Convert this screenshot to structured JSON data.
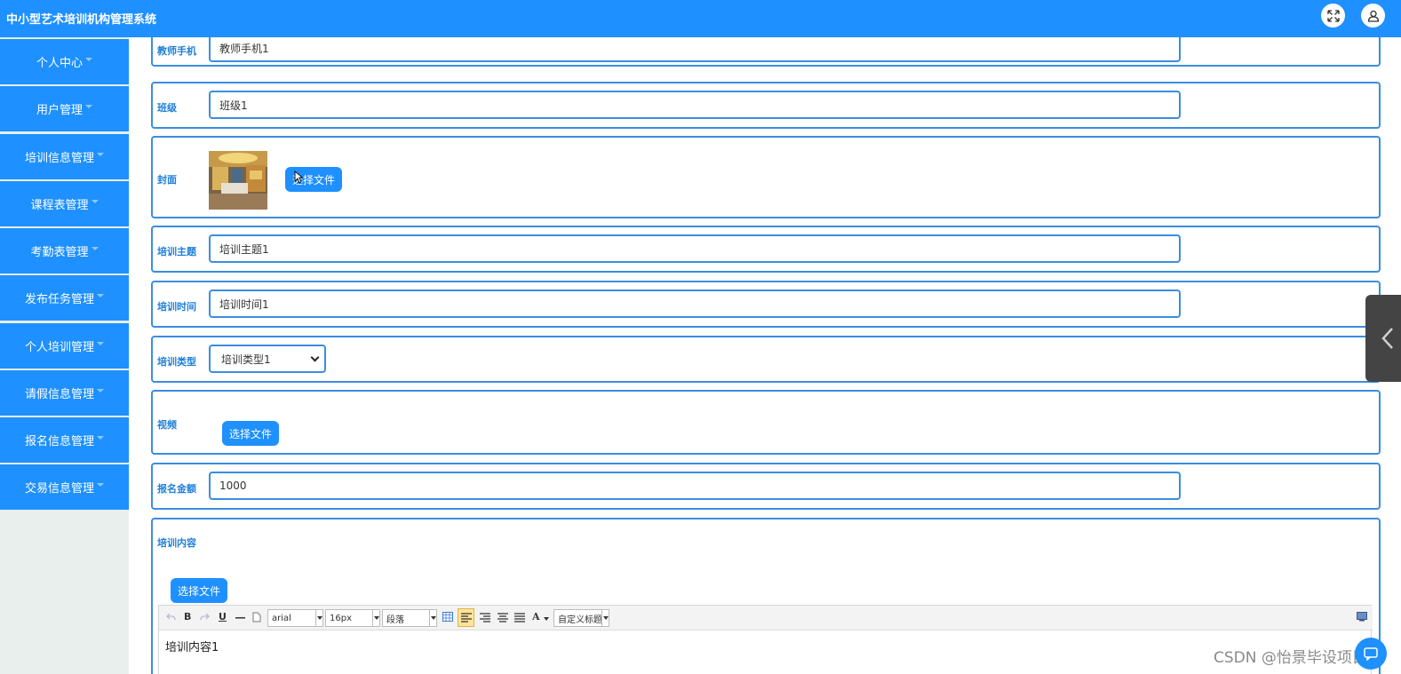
{
  "app": {
    "title": "中小型艺术培训机构管理系统",
    "fullscreen_icon": "expand-icon",
    "user_icon": "user-icon"
  },
  "sidebar": {
    "items": [
      {
        "label": "个人中心"
      },
      {
        "label": "用户管理"
      },
      {
        "label": "培训信息管理"
      },
      {
        "label": "课程表管理"
      },
      {
        "label": "考勤表管理"
      },
      {
        "label": "发布任务管理"
      },
      {
        "label": "个人培训管理"
      },
      {
        "label": "请假信息管理"
      },
      {
        "label": "报名信息管理"
      },
      {
        "label": "交易信息管理"
      }
    ]
  },
  "form": {
    "teacher_phone": {
      "label": "教师手机",
      "value": "教师手机1"
    },
    "class": {
      "label": "班级",
      "value": "班级1"
    },
    "cover": {
      "label": "封面",
      "button": "选择文件"
    },
    "topic": {
      "label": "培训主题",
      "value": "培训主题1"
    },
    "time": {
      "label": "培训时间",
      "value": "培训时间1"
    },
    "type": {
      "label": "培训类型",
      "selected": "培训类型1"
    },
    "video": {
      "label": "视频",
      "button": "选择文件"
    },
    "fee": {
      "label": "报名金额",
      "value": "1000"
    },
    "content": {
      "label": "培训内容",
      "button": "选择文件",
      "toolbar": {
        "bold": "B",
        "underline": "U",
        "font_family": "arial",
        "font_size": "16px",
        "paragraph": "段落",
        "font_color": "A",
        "custom_title": "自定义标题"
      },
      "text": "培训内容1"
    }
  },
  "watermark": "CSDN @怡景毕设项目",
  "colors": {
    "primary": "#1e90ff",
    "border": "#3a8de0",
    "label": "#1e7fd8"
  }
}
